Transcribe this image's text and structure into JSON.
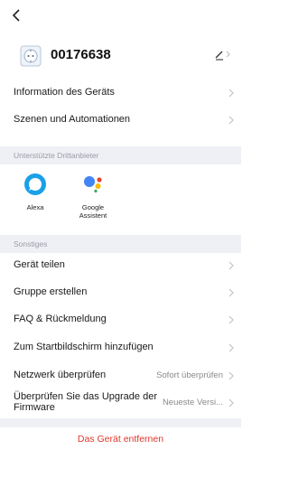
{
  "nav": {
    "back_glyph": "<"
  },
  "device": {
    "name": "00176638",
    "icon": "smart-plug-icon"
  },
  "settings": {
    "info_label": "Information des Geräts",
    "scenes_label": "Szenen und Automationen"
  },
  "third_party": {
    "section_title": "Unterstützte Drittanbieter",
    "alexa_label": "Alexa",
    "google_label_line1": "Google",
    "google_label_line2": "Assistent"
  },
  "misc": {
    "section_title": "Sonstiges",
    "share_label": "Gerät teilen",
    "group_label": "Gruppe erstellen",
    "faq_label": "FAQ & Rückmeldung",
    "homescreen_label": "Zum Startbildschirm hinzufügen",
    "network_label": "Netzwerk überprüfen",
    "network_value": "Sofort überprüfen",
    "upgrade_label": "Überprüfen Sie das Upgrade der Firmware",
    "upgrade_value": "Neueste Versi..."
  },
  "remove_label": "Das Gerät entfernen",
  "colors": {
    "accent_red": "#e0352b",
    "section_bg": "#eef0f5",
    "alexa_blue": "#1aa0e8"
  }
}
